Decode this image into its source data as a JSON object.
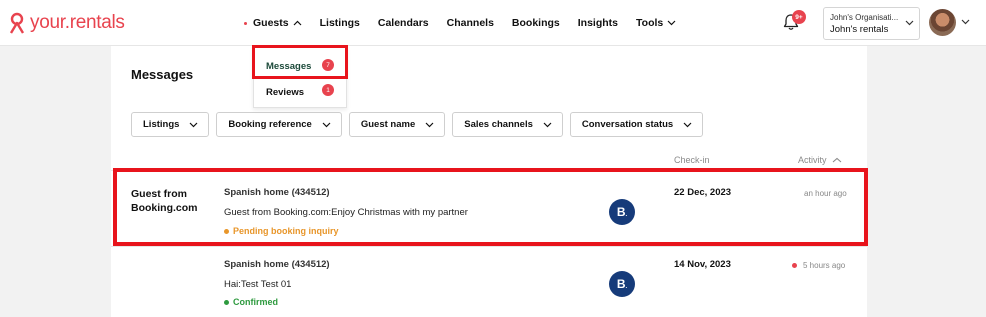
{
  "brand": {
    "name": "your.rentals",
    "color": "#e8434e"
  },
  "nav": {
    "items": [
      {
        "label": "Guests",
        "active": true
      },
      {
        "label": "Listings"
      },
      {
        "label": "Calendars"
      },
      {
        "label": "Channels"
      },
      {
        "label": "Bookings"
      },
      {
        "label": "Insights"
      },
      {
        "label": "Tools"
      }
    ],
    "notification_badge": "9+"
  },
  "org": {
    "organisation": "John's Organisati...",
    "account": "John's rentals"
  },
  "guests_menu": {
    "items": [
      {
        "label": "Messages",
        "badge": "7"
      },
      {
        "label": "Reviews",
        "badge": "1"
      }
    ]
  },
  "page": {
    "title": "Messages"
  },
  "filters": [
    {
      "label": "Listings"
    },
    {
      "label": "Booking reference"
    },
    {
      "label": "Guest name"
    },
    {
      "label": "Sales channels"
    },
    {
      "label": "Conversation status"
    }
  ],
  "columns": {
    "checkin": "Check-in",
    "activity": "Activity"
  },
  "conversations": [
    {
      "guest": "Guest from Booking.com",
      "property": "Spanish home (434512)",
      "message": "Guest from Booking.com:Enjoy Christmas with my partner",
      "status": "Pending booking inquiry",
      "status_color": "#e8962a",
      "channel_icon": "booking-com-icon",
      "checkin": "22 Dec, 2023",
      "activity": "an hour ago",
      "unread": false
    },
    {
      "guest": "",
      "property": "Spanish home (434512)",
      "message": "Hai:Test Test 01",
      "status": "Confirmed",
      "status_color": "#2e9a3f",
      "channel_icon": "booking-com-icon",
      "checkin": "14 Nov, 2023",
      "activity": "5 hours ago",
      "unread": true
    }
  ]
}
